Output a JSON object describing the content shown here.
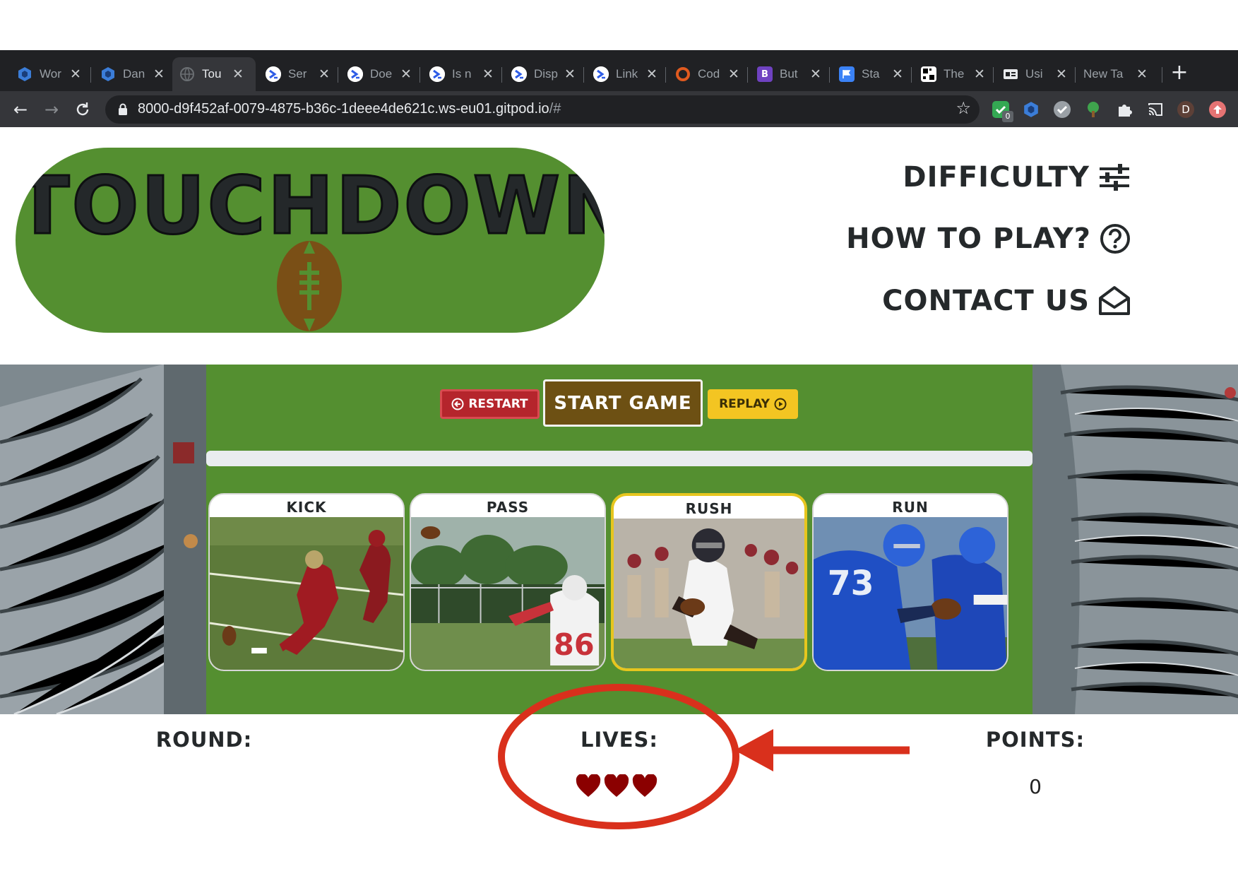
{
  "browser": {
    "tabs": [
      {
        "title": "Wor",
        "icon": "hexagon-icon",
        "color": "#2b6cb0"
      },
      {
        "title": "Dan",
        "icon": "hexagon-icon",
        "color": "#2b6cb0"
      },
      {
        "title": "Tou",
        "icon": "globe-icon",
        "color": "#6b6f73"
      },
      {
        "title": "Ser",
        "icon": "terminal-icon",
        "color": "#2e5ce6"
      },
      {
        "title": "Doe",
        "icon": "terminal-icon",
        "color": "#2e5ce6"
      },
      {
        "title": "Is n",
        "icon": "terminal-icon",
        "color": "#2e5ce6"
      },
      {
        "title": "Disp",
        "icon": "terminal-icon",
        "color": "#2e5ce6"
      },
      {
        "title": "Link",
        "icon": "terminal-icon",
        "color": "#2e5ce6"
      },
      {
        "title": "Cod",
        "icon": "ring-icon",
        "color": "#e05a1f"
      },
      {
        "title": "But",
        "icon": "bootstrap-icon",
        "color": "#6f42c1"
      },
      {
        "title": "Sta",
        "icon": "flag-icon",
        "color": "#3b82f6"
      },
      {
        "title": "The",
        "icon": "qr-icon",
        "color": "#ffffff"
      },
      {
        "title": "Usi",
        "icon": "card-icon",
        "color": "#e8eaed"
      },
      {
        "title": "New Ta",
        "icon": "",
        "color": ""
      }
    ],
    "url_main": "8000-d9f452af-0079-4875-b36c-1deee4de621c.ws-eu01.gitpod.io",
    "url_hash": "/#",
    "extension_badge": "0",
    "profile_initial": "D"
  },
  "site": {
    "logo_title": "TOUCHDOWN",
    "nav": {
      "difficulty": "DIFFICULTY",
      "how_to_play": "HOW TO PLAY?",
      "contact": "CONTACT US"
    },
    "buttons": {
      "restart": "RESTART",
      "start": "START GAME",
      "replay": "REPLAY"
    },
    "progress_fraction": 0,
    "cards": [
      {
        "label": "KICK",
        "selected": false
      },
      {
        "label": "PASS",
        "selected": false
      },
      {
        "label": "RUSH",
        "selected": true
      },
      {
        "label": "RUN",
        "selected": false
      }
    ],
    "stats": {
      "round_label": "ROUND:",
      "round_value": "",
      "lives_label": "LIVES:",
      "lives_count": 3,
      "points_label": "POINTS:",
      "points_value": "0"
    }
  },
  "colors": {
    "green": "#548f30",
    "restart": "#b5252c",
    "start": "#6d5013",
    "replay": "#f3c522",
    "selected_border": "#e7c61e",
    "heart": "#8b0000",
    "annotation": "#d9301c"
  }
}
